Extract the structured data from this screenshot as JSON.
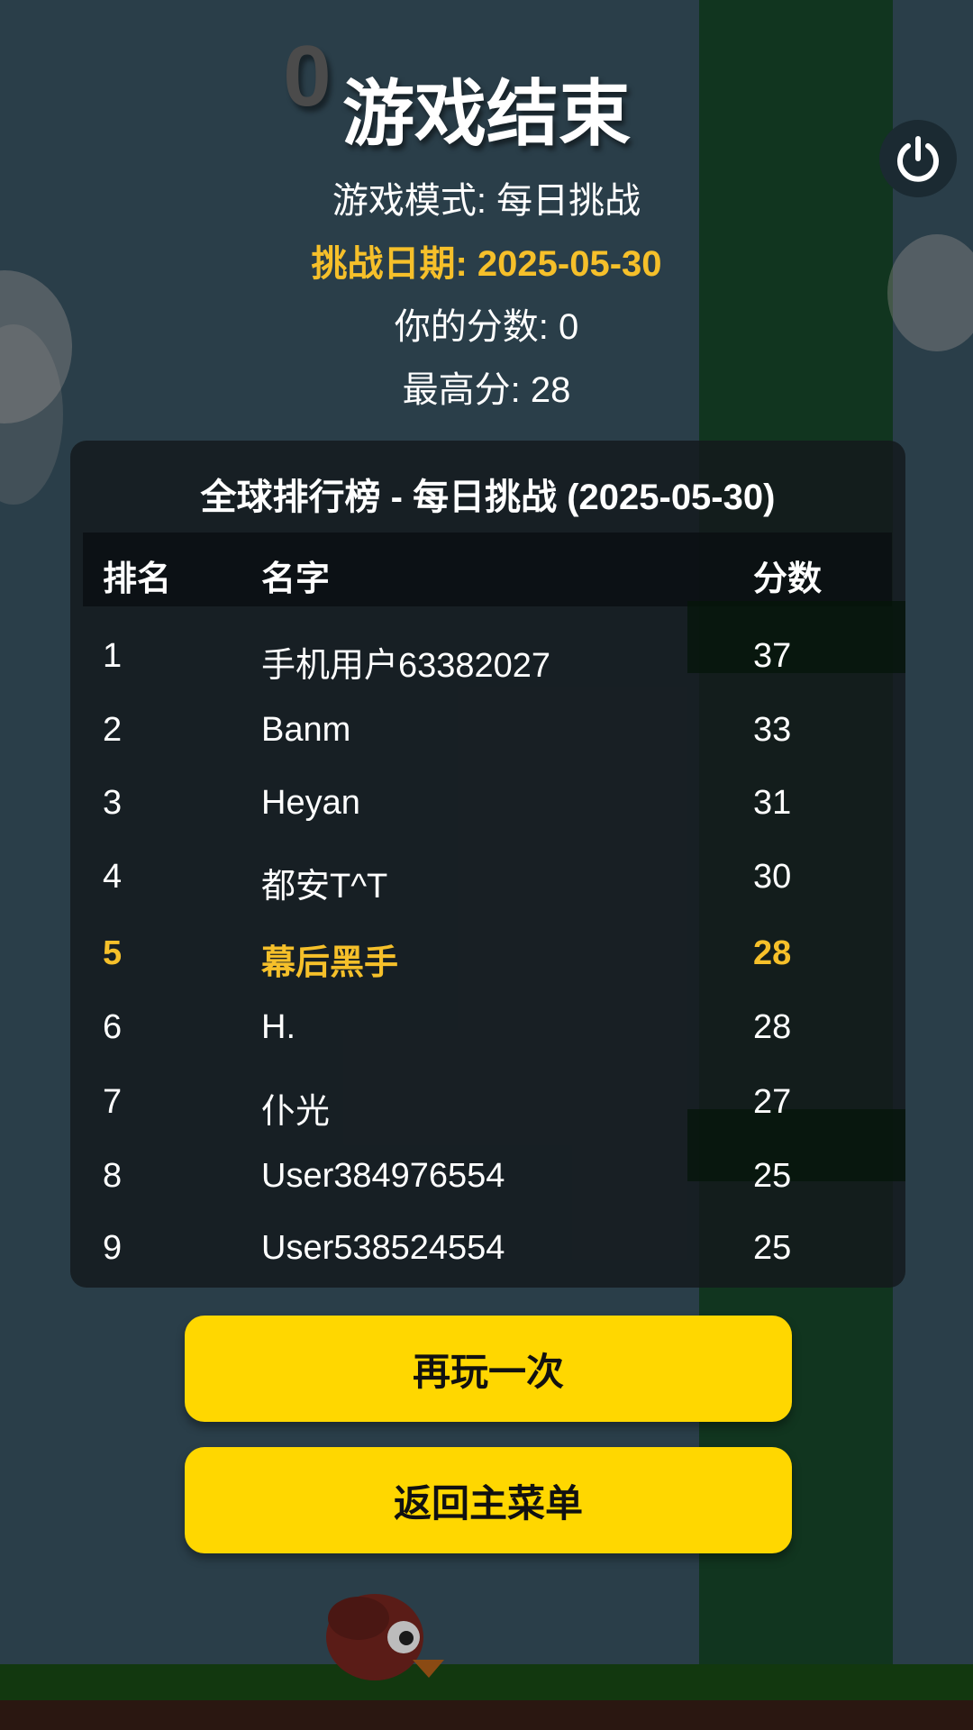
{
  "game": {
    "current_score": "0",
    "title": "游戏结束",
    "mode_text": "游戏模式: 每日挑战",
    "date_text": "挑战日期: 2025-05-30",
    "your_score_text": "你的分数: 0",
    "best_score_text": "最高分: 28"
  },
  "leaderboard": {
    "title": "全球排行榜 - 每日挑战 (2025-05-30)",
    "headers": {
      "rank": "排名",
      "name": "名字",
      "score": "分数"
    },
    "rows": [
      {
        "rank": "1",
        "name": "手机用户63382027",
        "score": "37"
      },
      {
        "rank": "2",
        "name": "Banm",
        "score": "33"
      },
      {
        "rank": "3",
        "name": "Heyan",
        "score": "31"
      },
      {
        "rank": "4",
        "name": "都安T^T",
        "score": "30"
      },
      {
        "rank": "5",
        "name": "幕后黑手",
        "score": "28"
      },
      {
        "rank": "6",
        "name": "H.",
        "score": "28"
      },
      {
        "rank": "7",
        "name": "仆光",
        "score": "27"
      },
      {
        "rank": "8",
        "name": "User384976554",
        "score": "25"
      },
      {
        "rank": "9",
        "name": "User538524554",
        "score": "25"
      }
    ],
    "highlight_color": "#f6c02a"
  },
  "buttons": {
    "play_again": "再玩一次",
    "main_menu": "返回主菜单"
  },
  "icons": {
    "power": "power-icon"
  },
  "colors": {
    "accent": "#ffd700",
    "highlight": "#f6c02a",
    "background": "#2a3e49"
  }
}
